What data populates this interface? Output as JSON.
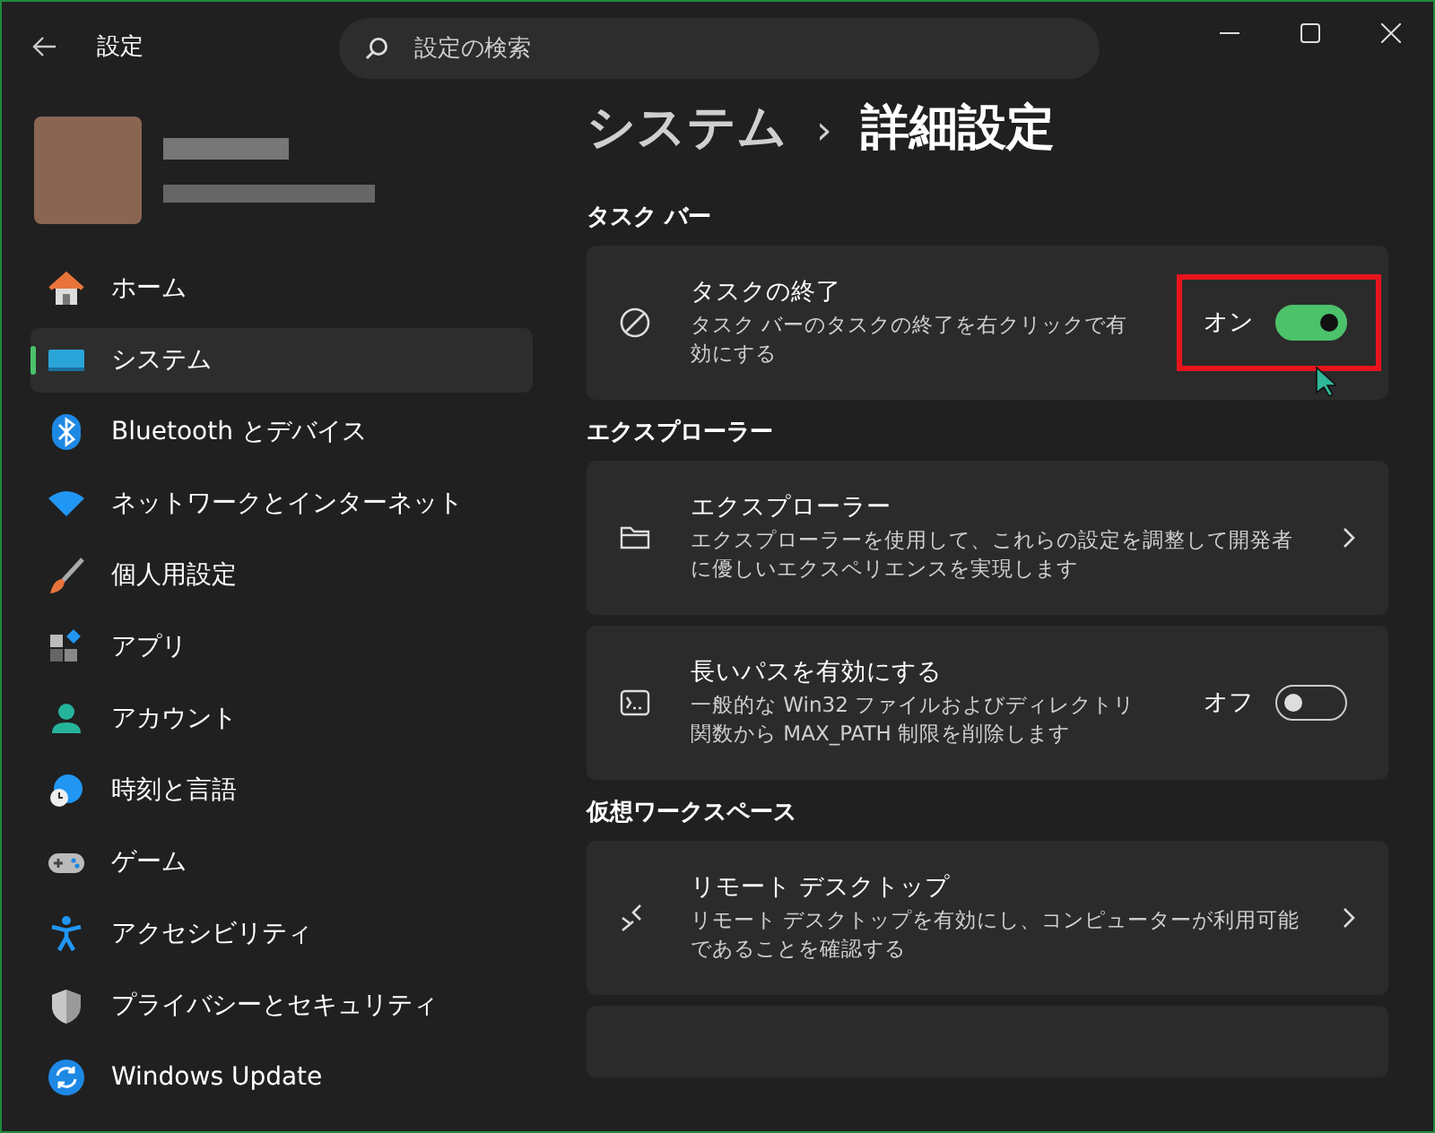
{
  "window": {
    "title": "設定"
  },
  "search": {
    "placeholder": "設定の検索"
  },
  "sidebar": {
    "items": [
      {
        "label": "ホーム",
        "selected": false
      },
      {
        "label": "システム",
        "selected": true
      },
      {
        "label": "Bluetooth とデバイス",
        "selected": false
      },
      {
        "label": "ネットワークとインターネット",
        "selected": false
      },
      {
        "label": "個人用設定",
        "selected": false
      },
      {
        "label": "アプリ",
        "selected": false
      },
      {
        "label": "アカウント",
        "selected": false
      },
      {
        "label": "時刻と言語",
        "selected": false
      },
      {
        "label": "ゲーム",
        "selected": false
      },
      {
        "label": "アクセシビリティ",
        "selected": false
      },
      {
        "label": "プライバシーとセキュリティ",
        "selected": false
      },
      {
        "label": "Windows Update",
        "selected": false
      }
    ]
  },
  "breadcrumb": {
    "parent": "システム",
    "separator": "›",
    "current": "詳細設定"
  },
  "sections": [
    {
      "heading": "タスク バー",
      "cards": [
        {
          "kind": "toggle",
          "title": "タスクの終了",
          "description": "タスク バーのタスクの終了を右クリックで有効にする",
          "state_label": "オン",
          "on": true,
          "highlighted": true
        }
      ]
    },
    {
      "heading": "エクスプローラー",
      "cards": [
        {
          "kind": "link",
          "title": "エクスプローラー",
          "description": "エクスプローラーを使用して、これらの設定を調整して開発者に優しいエクスペリエンスを実現します"
        },
        {
          "kind": "toggle",
          "title": "長いパスを有効にする",
          "description": "一般的な Win32 ファイルおよびディレクトリ関数から MAX_PATH 制限を削除します",
          "state_label": "オフ",
          "on": false,
          "highlighted": false
        }
      ]
    },
    {
      "heading": "仮想ワークスペース",
      "cards": [
        {
          "kind": "link",
          "title": "リモート デスクトップ",
          "description": "リモート デスクトップを有効にし、コンピューターが利用可能であることを確認する"
        },
        {
          "kind": "blank"
        }
      ]
    }
  ]
}
